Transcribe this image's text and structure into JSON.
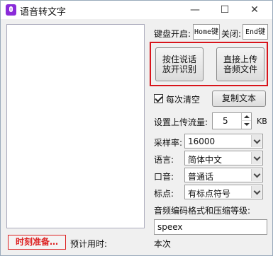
{
  "window": {
    "title": "语音转文字",
    "minimize_label": "—",
    "maximize_label": "☐",
    "close_label": "✕"
  },
  "transcript": {
    "text": ""
  },
  "hotkeys": {
    "start_label": "键盘开启:",
    "start_value": "Home键",
    "close_label": "关闭:",
    "close_value": "End键"
  },
  "buttons": {
    "hold_to_speak": [
      "按住说话",
      "放开识别"
    ],
    "upload_audio": [
      "直接上传",
      "音频文件"
    ],
    "copy_text": "复制文本"
  },
  "clear_each_time": {
    "label": "每次清空",
    "checked": true
  },
  "upload_rate": {
    "label": "设置上传流量:",
    "value": "5",
    "unit": "KB"
  },
  "settings": [
    {
      "label": "采样率:",
      "value": "16000"
    },
    {
      "label": "语言:",
      "value": "简体中文"
    },
    {
      "label": "口音:",
      "value": "普通话"
    },
    {
      "label": "标点:",
      "value": "有标点符号"
    }
  ],
  "codec": {
    "label": "音频编码格式和压缩等级:",
    "value": "speex"
  },
  "footer": {
    "timer_button": "时刻准备…",
    "estimated_time_label": "预计用时:",
    "this_time_label": "本次"
  }
}
